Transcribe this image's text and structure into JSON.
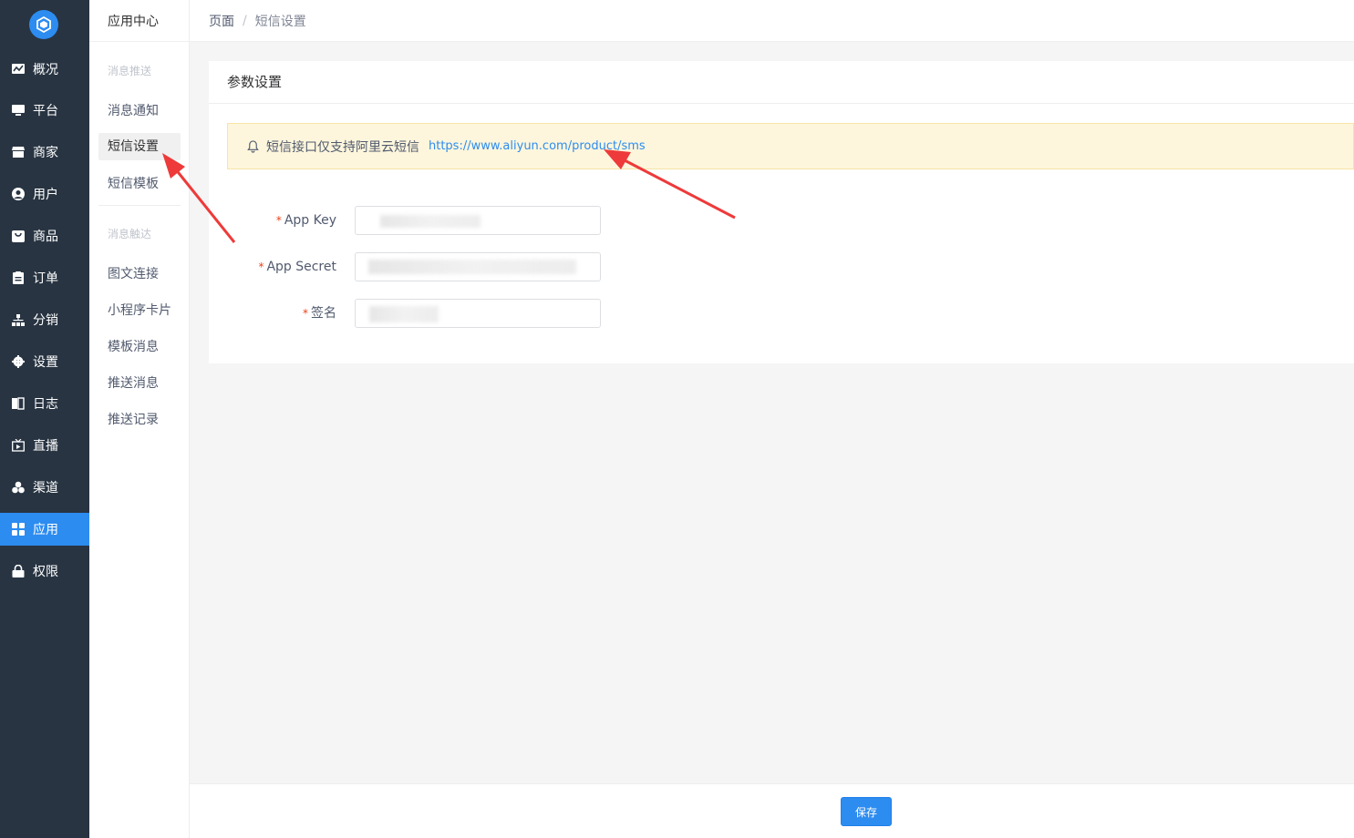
{
  "sidebar": {
    "logo_icon": "cube-logo-icon",
    "items": [
      {
        "label": "概况",
        "icon": "chart-icon"
      },
      {
        "label": "平台",
        "icon": "monitor-icon"
      },
      {
        "label": "商家",
        "icon": "store-icon"
      },
      {
        "label": "用户",
        "icon": "user-icon"
      },
      {
        "label": "商品",
        "icon": "bag-icon"
      },
      {
        "label": "订单",
        "icon": "clipboard-icon"
      },
      {
        "label": "分销",
        "icon": "sitemap-icon"
      },
      {
        "label": "设置",
        "icon": "gear-icon"
      },
      {
        "label": "日志",
        "icon": "book-icon"
      },
      {
        "label": "直播",
        "icon": "tv-icon"
      },
      {
        "label": "渠道",
        "icon": "cubes-icon"
      },
      {
        "label": "应用",
        "icon": "grid-icon",
        "active": true
      },
      {
        "label": "权限",
        "icon": "lock-icon"
      }
    ]
  },
  "submenu": {
    "title": "应用中心",
    "group1": "消息推送",
    "group1_items": [
      "消息通知",
      "短信设置",
      "短信模板"
    ],
    "group2": "消息触达",
    "group2_items": [
      "图文连接",
      "小程序卡片",
      "模板消息",
      "推送消息",
      "推送记录"
    ]
  },
  "breadcrumb": {
    "home": "页面",
    "separator": "/",
    "current": "短信设置"
  },
  "card": {
    "title": "参数设置",
    "notice_text": "短信接口仅支持阿里云短信",
    "notice_link": "https://www.aliyun.com/product/sms"
  },
  "form": {
    "required_mark": "*",
    "app_key_label": "App Key",
    "app_key_value": "",
    "app_secret_label": "App Secret",
    "app_secret_value": "",
    "sign_label": "签名",
    "sign_value": ""
  },
  "footer": {
    "save_label": "保存"
  },
  "colors": {
    "sidebar_bg": "#283442",
    "accent": "#2d8cf0",
    "notice_bg": "#fdf6dc",
    "required": "#ed4014",
    "annotation_arrow": "#ee3a3a"
  }
}
